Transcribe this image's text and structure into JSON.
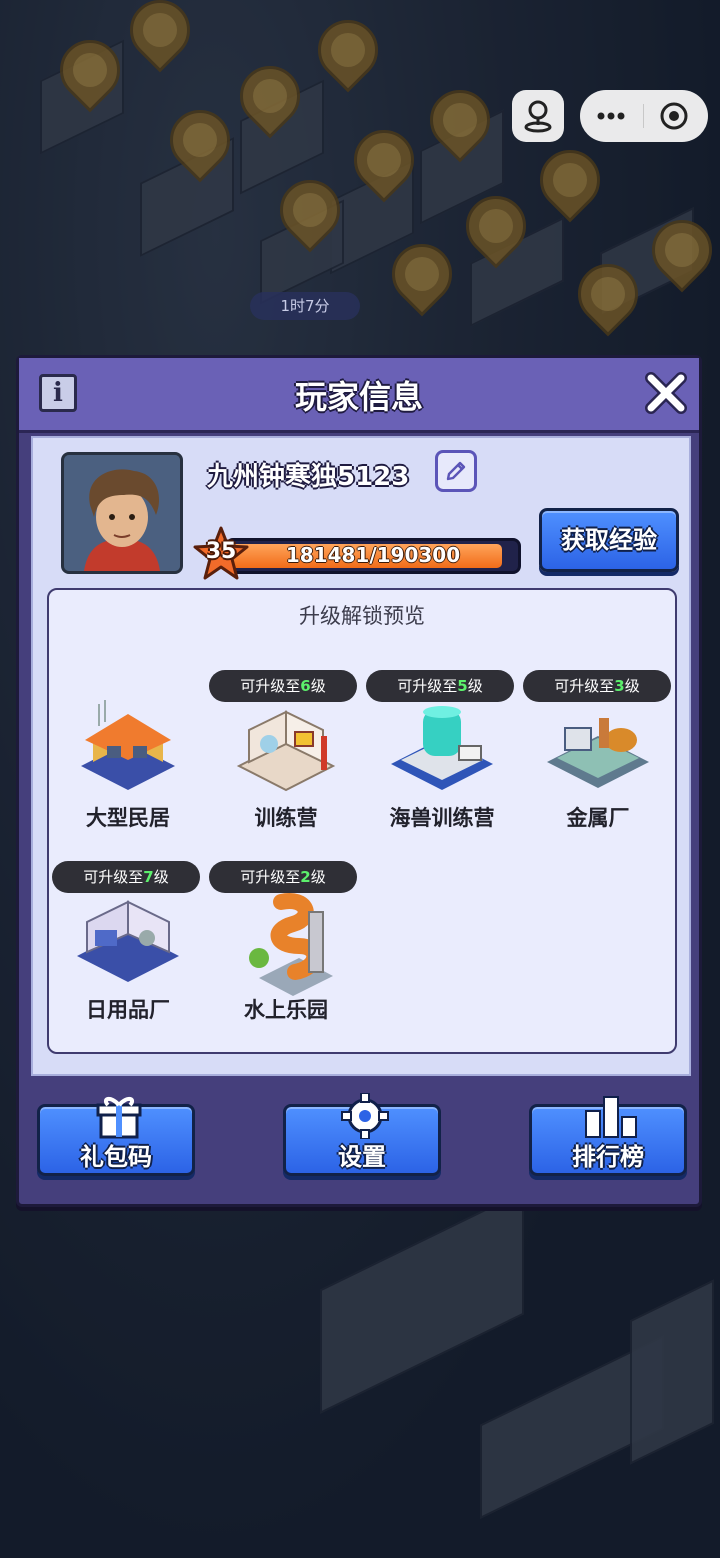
{
  "timer": "1时7分",
  "dialog": {
    "title": "玩家信息",
    "player": {
      "name": "九州钟寒独5123",
      "level": "35",
      "exp_text": "181481/190300",
      "exp_current": 181481,
      "exp_max": 190300
    },
    "exp_button": "获取经验",
    "preview": {
      "title": "升级解锁预览",
      "tag_prefix": "可升级至",
      "tag_suffix": "级",
      "buildings": [
        {
          "name": "大型民居",
          "unlock_level": null
        },
        {
          "name": "训练营",
          "unlock_level": "6"
        },
        {
          "name": "海兽训练营",
          "unlock_level": "5"
        },
        {
          "name": "金属厂",
          "unlock_level": "3"
        },
        {
          "name": "日用品厂",
          "unlock_level": "7"
        },
        {
          "name": "水上乐园",
          "unlock_level": "2"
        }
      ]
    },
    "footer": {
      "gift_code": "礼包码",
      "settings": "设置",
      "leaderboard": "排行榜"
    }
  },
  "colors": {
    "dialog_bg": "#453f7c",
    "header_bg": "#6a61b6",
    "panel_bg": "#d7dcf7",
    "button_blue": "#3a78f2",
    "exp_fill": "#f5801f",
    "level_tag_green": "#5cf06c"
  }
}
